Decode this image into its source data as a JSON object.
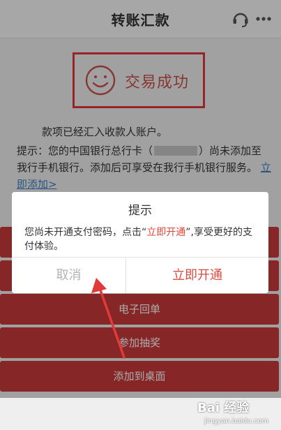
{
  "header": {
    "title": "转账汇款",
    "icons": [
      "headset-icon",
      "more-icon"
    ]
  },
  "result": {
    "status": "交易成功",
    "message": "款项已经汇入收款人账户。",
    "tip_prefix": "提示：您的中国银行总行卡（",
    "tip_suffix": "）尚未添加至我行手机银行。添加后可享受在我行手机银行服务。",
    "tip_link": "立即添加>"
  },
  "buttons": [
    {
      "label": ""
    },
    {
      "label": ""
    },
    {
      "label": "电子回单"
    },
    {
      "label": "参加抽奖"
    },
    {
      "label": "添加到桌面"
    }
  ],
  "dialog": {
    "title": "提示",
    "body_before": "您尚未开通支付密码，点击“",
    "body_highlight": "立即开通",
    "body_after": "”,享受更好的支付体验。",
    "cancel": "取消",
    "confirm": "立即开通"
  },
  "watermark": {
    "main": "Bai 经验",
    "sub": "jingyan.baidu.com"
  },
  "colors": {
    "accent_red": "#c93a3a",
    "highlight_red": "#e0443b",
    "link_blue": "#3d7fc2",
    "annotation_red": "#e03a3a"
  }
}
